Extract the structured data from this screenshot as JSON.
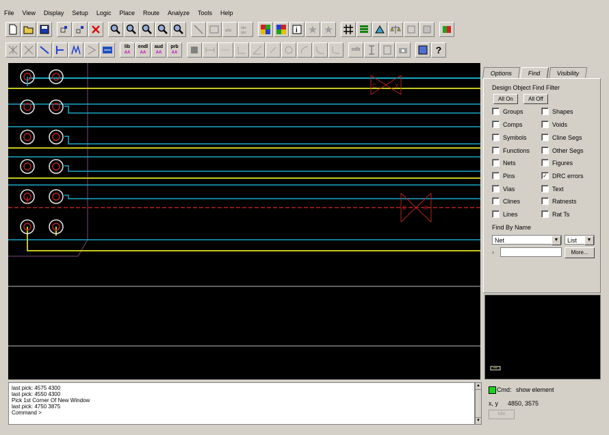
{
  "menu": [
    "File",
    "View",
    "Display",
    "Setup",
    "Logic",
    "Place",
    "Route",
    "Analyze",
    "Tools",
    "Help"
  ],
  "toolbar2_lib": [
    {
      "top": "lib",
      "bottom": "AA"
    },
    {
      "top": "endl",
      "bottom": "AA"
    },
    {
      "top": "aud",
      "bottom": "AA"
    },
    {
      "top": "prb",
      "bottom": "AA"
    }
  ],
  "toolbar_misc": {
    "odb": "odb",
    "question": "?"
  },
  "canvas": {
    "drc_marker_label": "DRC"
  },
  "find_panel": {
    "tabs": [
      "Options",
      "Find",
      "Visibility"
    ],
    "filter_title": "Design Object Find Filter",
    "all_on": "All On",
    "all_off": "All Off",
    "left_options": [
      {
        "label": "Groups",
        "checked": false
      },
      {
        "label": "Comps",
        "checked": false
      },
      {
        "label": "Symbols",
        "checked": false
      },
      {
        "label": "Functions",
        "checked": false
      },
      {
        "label": "Nets",
        "checked": false
      },
      {
        "label": "Pins",
        "checked": false
      },
      {
        "label": "Vias",
        "checked": false
      },
      {
        "label": "Clines",
        "checked": false
      },
      {
        "label": "Lines",
        "checked": false
      }
    ],
    "right_options": [
      {
        "label": "Shapes",
        "checked": false
      },
      {
        "label": "Voids",
        "checked": false
      },
      {
        "label": "Cline Segs",
        "checked": false
      },
      {
        "label": "Other Segs",
        "checked": false
      },
      {
        "label": "Figures",
        "checked": false
      },
      {
        "label": "DRC errors",
        "checked": true
      },
      {
        "label": "Text",
        "checked": false
      },
      {
        "label": "Ratnests",
        "checked": false
      },
      {
        "label": "Rat Ts",
        "checked": false
      }
    ],
    "find_by_name": "Find By Name",
    "type_select": "Net",
    "mode_select": "List",
    "name_value": "",
    "more_button": "More..."
  },
  "console": {
    "lines": [
      "last pick:  4575  4300",
      "last pick:  4550  4300",
      "Pick 1st Corner Of New Window",
      "last pick:  4750  3875",
      "Command >"
    ]
  },
  "status": {
    "cmd_label": "Cmd:",
    "cmd_value": "show element",
    "xy_label": "x, y",
    "xy_value": "4850, 3575",
    "button": "Idle",
    "indicator_color": "#1cd41c"
  },
  "colors": {
    "canvas_bg": "#000000",
    "trace_cyan": "#1aa7c9",
    "trace_yellow": "#c8c81e",
    "pad_ring": "#e8e8e8",
    "board_outline": "#7a4a7a",
    "drc_red": "#b4241e",
    "grid_white": "#c0c0c0"
  }
}
